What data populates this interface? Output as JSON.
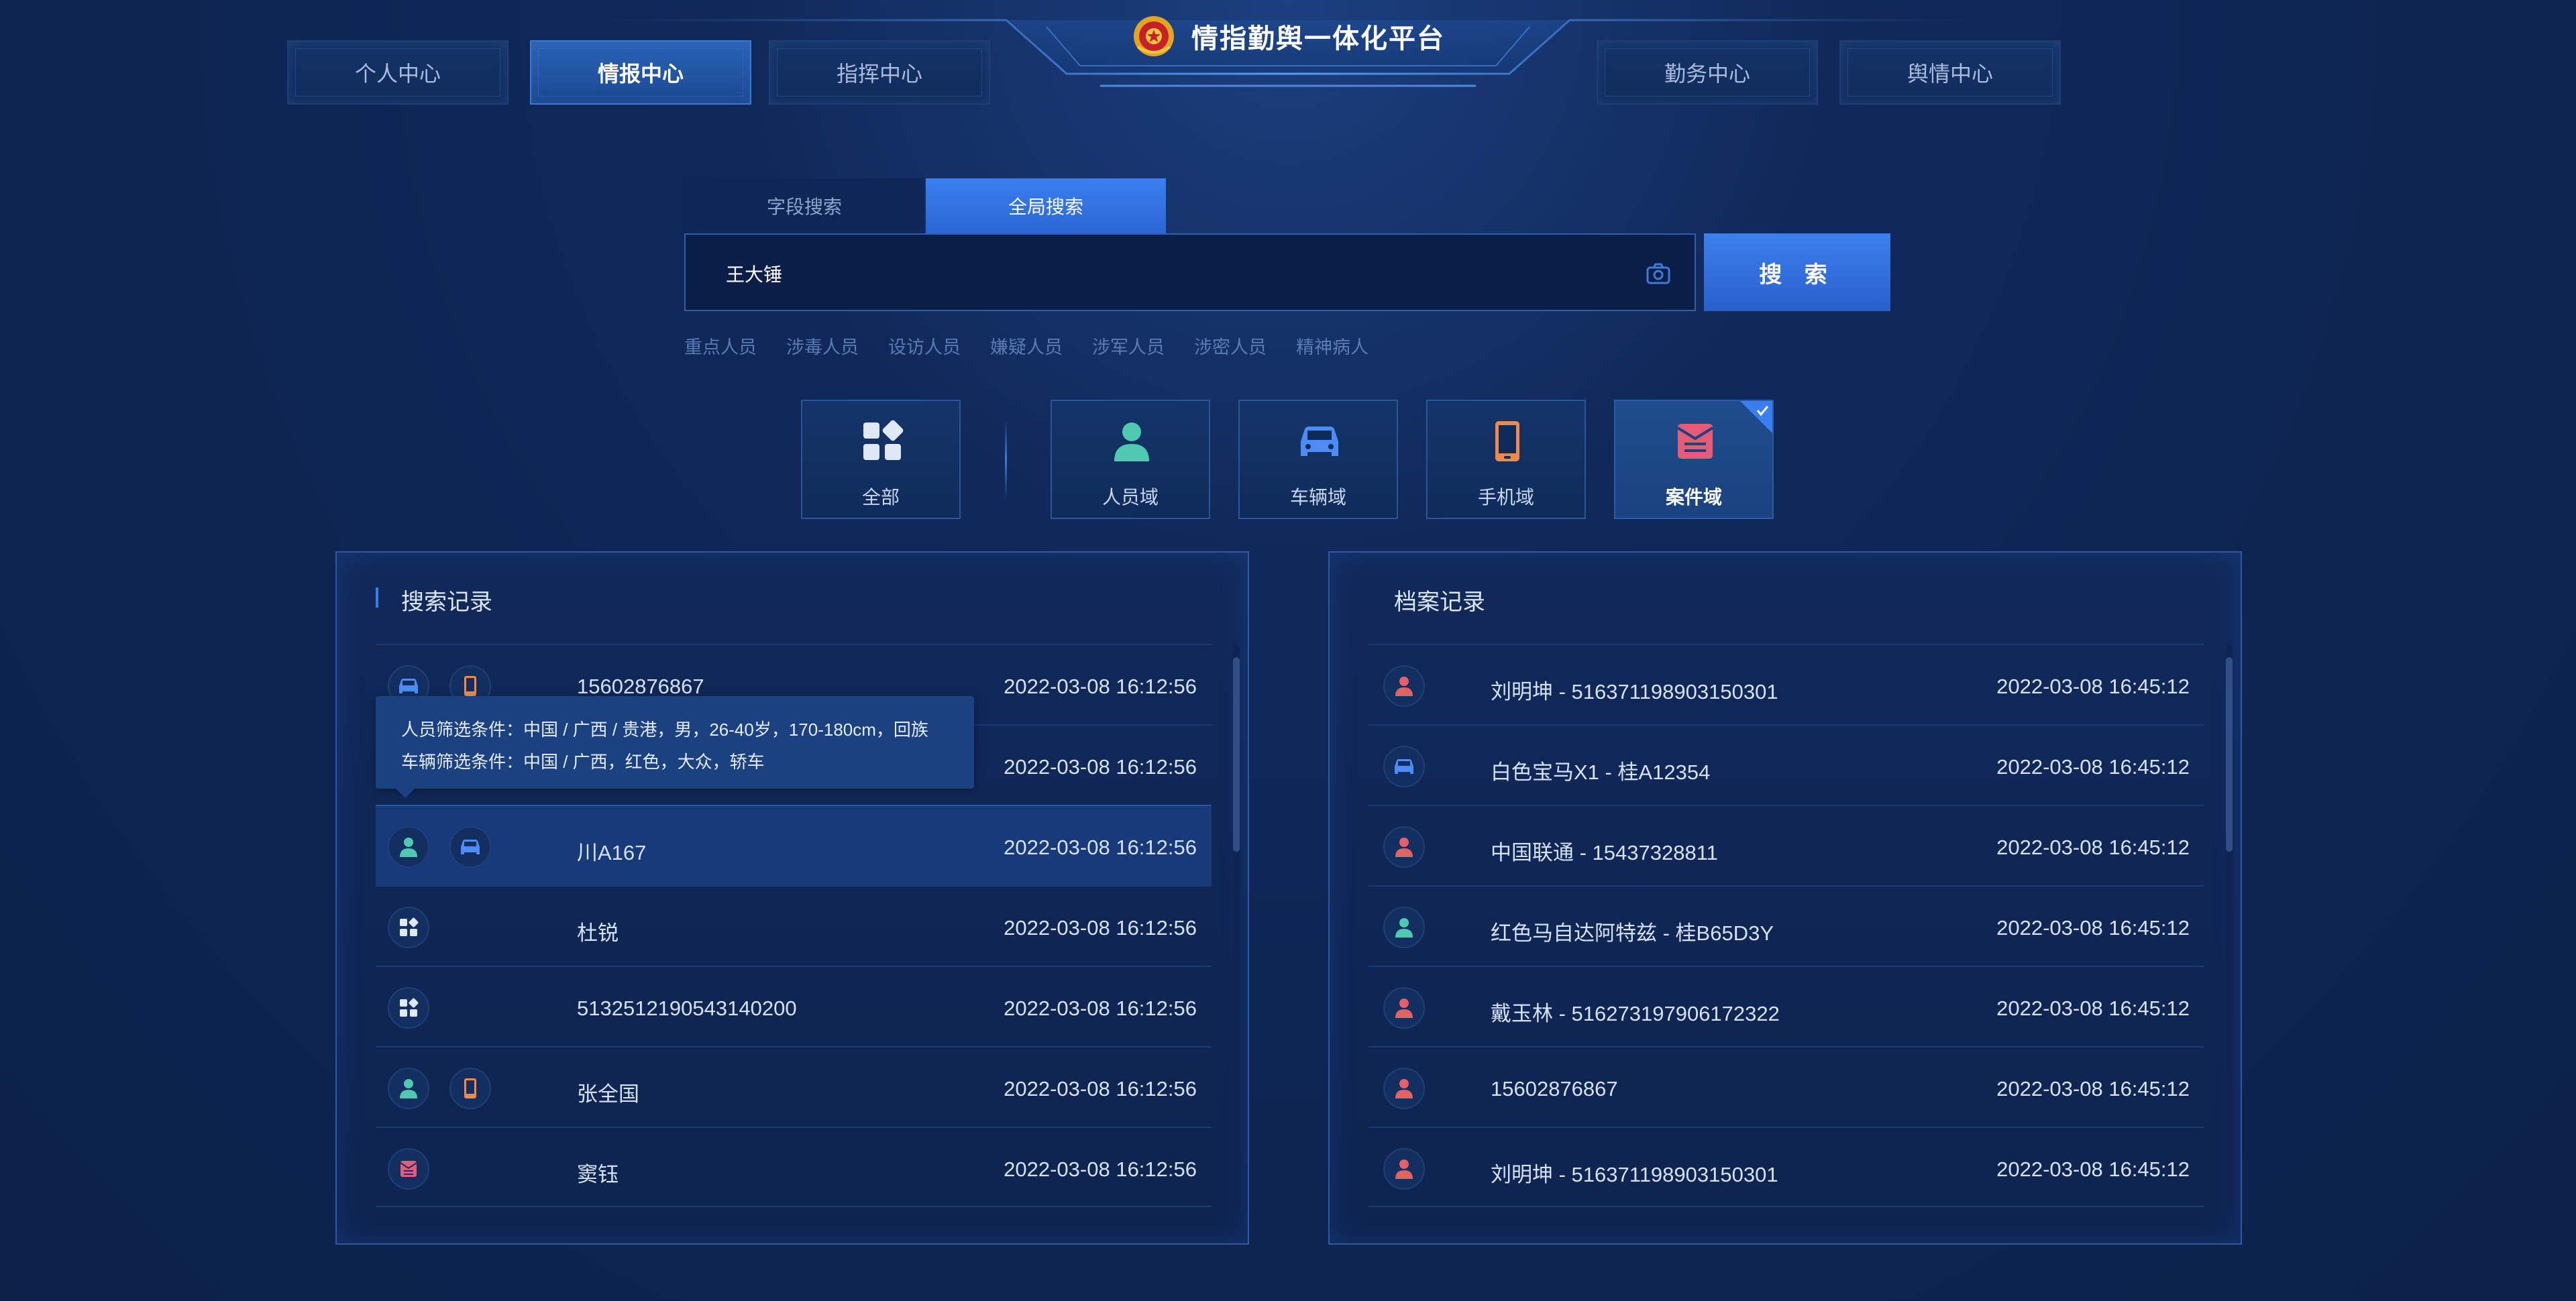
{
  "header": {
    "title": "情指勤舆一体化平台",
    "nav_left": [
      "个人中心",
      "情报中心",
      "指挥中心"
    ],
    "nav_right": [
      "勤务中心",
      "舆情中心"
    ],
    "active_nav": "情报中心"
  },
  "search": {
    "tabs": [
      "字段搜索",
      "全局搜索"
    ],
    "active_tab": "全局搜索",
    "query": "王大锤",
    "button_label": "搜 索",
    "quick_tags": [
      "重点人员",
      "涉毒人员",
      "设访人员",
      "嫌疑人员",
      "涉军人员",
      "涉密人员",
      "精神病人"
    ]
  },
  "domains": {
    "items": [
      {
        "label": "全部",
        "icon": "grid-icon"
      },
      {
        "label": "人员域",
        "icon": "person-icon"
      },
      {
        "label": "车辆域",
        "icon": "car-icon"
      },
      {
        "label": "手机域",
        "icon": "phone-icon"
      },
      {
        "label": "案件域",
        "icon": "case-icon"
      }
    ],
    "selected": "案件域"
  },
  "search_records": {
    "title": "搜索记录",
    "rows": [
      {
        "icons": [
          "car-icon",
          "phone-icon"
        ],
        "name": "15602876867",
        "time": "2022-03-08 16:12:56"
      },
      {
        "icons": [
          "person-icon",
          "car-icon"
        ],
        "name": "",
        "time": "2022-03-08 16:12:56"
      },
      {
        "icons": [
          "person-icon",
          "car-icon"
        ],
        "name": "川A167",
        "time": "2022-03-08 16:12:56"
      },
      {
        "icons": [
          "grid-icon"
        ],
        "name": "杜锐",
        "time": "2022-03-08 16:12:56"
      },
      {
        "icons": [
          "grid-icon"
        ],
        "name": "5132512190543140200",
        "time": "2022-03-08 16:12:56"
      },
      {
        "icons": [
          "person-icon",
          "phone-icon"
        ],
        "name": "张全国",
        "time": "2022-03-08 16:12:56"
      },
      {
        "icons": [
          "case-icon"
        ],
        "name": "窦钰",
        "time": "2022-03-08 16:12:56"
      }
    ],
    "tooltip": {
      "line1": "人员筛选条件：中国 / 广西 / 贵港，男，26-40岁，170-180cm，回族",
      "line2": "车辆筛选条件：中国 / 广西，红色，大众，轿车"
    }
  },
  "archive_records": {
    "title": "档案记录",
    "rows": [
      {
        "icon": "person-red-icon",
        "name": "刘明坤 - 516371198903150301",
        "time": "2022-03-08 16:45:12"
      },
      {
        "icon": "car-icon",
        "name": "白色宝马X1 - 桂A12354",
        "time": "2022-03-08 16:45:12"
      },
      {
        "icon": "person-red-icon",
        "name": "中国联通 - 15437328811",
        "time": "2022-03-08 16:45:12"
      },
      {
        "icon": "person-icon",
        "name": "红色马自达阿特兹 - 桂B65D3Y",
        "time": "2022-03-08 16:45:12"
      },
      {
        "icon": "person-red-icon",
        "name": "戴玉林 - 516273197906172322",
        "time": "2022-03-08 16:45:12"
      },
      {
        "icon": "person-red-icon",
        "name": "15602876867",
        "time": "2022-03-08 16:45:12"
      },
      {
        "icon": "person-red-icon",
        "name": "刘明坤 - 516371198903150301",
        "time": "2022-03-08 16:45:12"
      }
    ]
  },
  "colors": {
    "accent": "#3a7ff0",
    "person": "#4fc9b0",
    "person_red": "#e5606a",
    "car": "#4d8cf5",
    "phone": "#f08a4b",
    "case": "#e85b78"
  }
}
